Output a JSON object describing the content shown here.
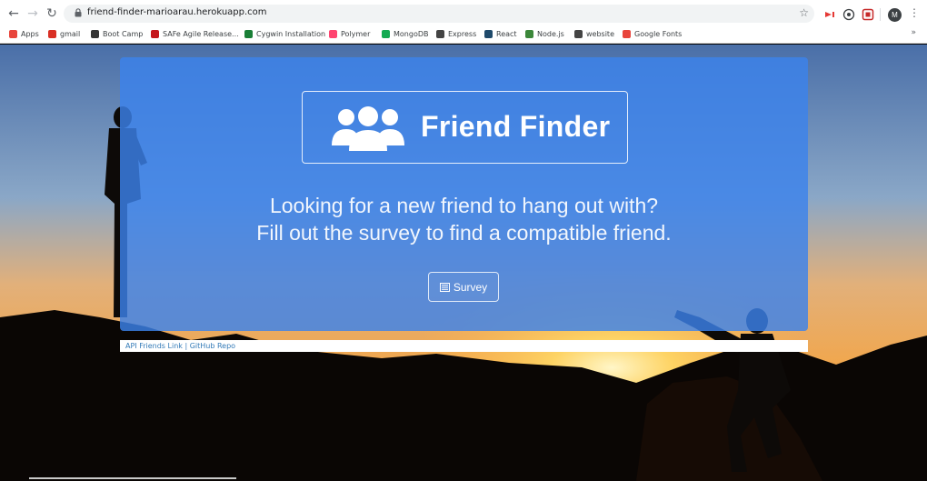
{
  "browser": {
    "url": "friend-finder-marioarau.herokuapp.com",
    "profile_initial": "M",
    "bookmarks": [
      {
        "label": "Apps",
        "color": "#e8453c"
      },
      {
        "label": "gmail",
        "color": "#d93025"
      },
      {
        "label": "Boot Camp",
        "color": "#333333"
      },
      {
        "label": "SAFe Agile Release...",
        "color": "#c4161c"
      },
      {
        "label": "Cygwin Installation",
        "color": "#1a7f37"
      },
      {
        "label": "Polymer",
        "color": "#ff4470"
      },
      {
        "label": "MongoDB",
        "color": "#13aa52"
      },
      {
        "label": "Express",
        "color": "#444444"
      },
      {
        "label": "React",
        "color": "#1f4a6b"
      },
      {
        "label": "Node.js",
        "color": "#3c873a"
      },
      {
        "label": "website",
        "color": "#444444"
      },
      {
        "label": "Google Fonts",
        "color": "#e8453c"
      }
    ],
    "bookmarks_overflow": "»"
  },
  "hero": {
    "title": "Friend Finder",
    "tagline_line1": "Looking for a new friend to hang out with?",
    "tagline_line2": "Fill out the survey to find a compatible friend.",
    "survey_button": "Survey"
  },
  "footer": {
    "api_link": "API Friends Link",
    "separator": "|",
    "github_link": "GitHub Repo"
  },
  "colors": {
    "jumbotron": "#3c82eb",
    "link": "#337ab7"
  }
}
